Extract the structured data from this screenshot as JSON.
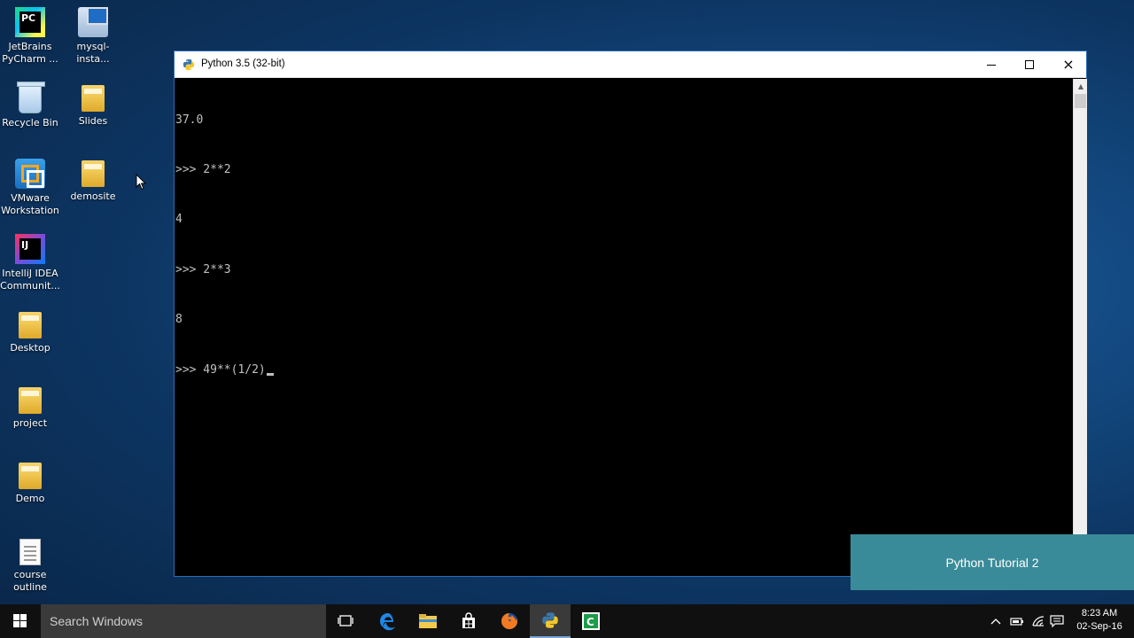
{
  "desktop": {
    "icons": [
      {
        "label": "JetBrains PyCharm ...",
        "icon": "pycharm-icon",
        "glyph": "PC"
      },
      {
        "label": "mysql-insta...",
        "icon": "mysql-installer-icon"
      },
      {
        "label": "Recycle Bin",
        "icon": "recycle-bin-icon"
      },
      {
        "label": "Slides",
        "icon": "folder-icon"
      },
      {
        "label": "VMware Workstation",
        "icon": "vmware-icon"
      },
      {
        "label": "demosite",
        "icon": "folder-icon"
      },
      {
        "label": "IntelliJ IDEA Communit...",
        "icon": "intellij-icon",
        "glyph": "IJ"
      },
      {
        "label": "Desktop",
        "icon": "folder-icon"
      },
      {
        "label": "project",
        "icon": "folder-icon"
      },
      {
        "label": "Demo",
        "icon": "folder-icon"
      },
      {
        "label": "course outline",
        "icon": "document-icon"
      }
    ]
  },
  "window": {
    "title": "Python 3.5 (32-bit)",
    "controls": {
      "minimize": "minimize",
      "maximize": "maximize",
      "close": "×"
    }
  },
  "console": {
    "lines": [
      "37.0",
      ">>> 2**2",
      "4",
      ">>> 2**3",
      "8",
      ">>> 49**(1/2)"
    ]
  },
  "overlay": {
    "text": "Python Tutorial 2"
  },
  "taskbar": {
    "search_placeholder": "Search Windows",
    "apps": [
      "task-view",
      "edge",
      "file-explorer",
      "store",
      "firefox",
      "python",
      "camtasia"
    ],
    "time": "8:23 AM",
    "date": "02-Sep-16"
  },
  "colors": {
    "console_bg": "#000000",
    "console_text": "#c0c0c0",
    "overlay_bg": "#3a8b99",
    "taskbar_bg": "#101010",
    "window_border": "#2c6db5"
  }
}
